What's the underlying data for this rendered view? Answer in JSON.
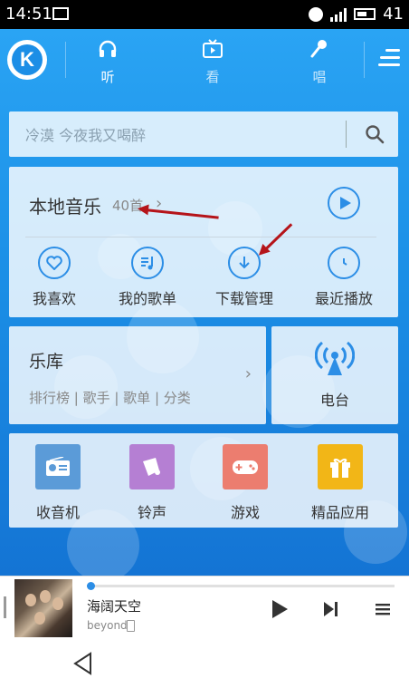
{
  "status": {
    "time": "14:51",
    "battery": "41"
  },
  "nav": {
    "tabs": [
      {
        "label": "听",
        "icon": "headphones-icon"
      },
      {
        "label": "看",
        "icon": "tv-icon"
      },
      {
        "label": "唱",
        "icon": "microphone-icon"
      }
    ]
  },
  "search": {
    "placeholder": "冷漠 今夜我又喝醉"
  },
  "local": {
    "title": "本地音乐",
    "count": "40首",
    "items": [
      {
        "label": "我喜欢",
        "icon": "heart-icon"
      },
      {
        "label": "我的歌单",
        "icon": "playlist-icon"
      },
      {
        "label": "下载管理",
        "icon": "download-icon"
      },
      {
        "label": "最近播放",
        "icon": "clock-icon"
      }
    ]
  },
  "library": {
    "title": "乐库",
    "tags": "排行榜 | 歌手 | 歌单 | 分类"
  },
  "radio": {
    "label": "电台"
  },
  "apps": [
    {
      "label": "收音机",
      "color": "#5b9bd8",
      "icon": "radio-icon"
    },
    {
      "label": "铃声",
      "color": "#b57fd3",
      "icon": "ringtone-icon"
    },
    {
      "label": "游戏",
      "color": "#ec7d6f",
      "icon": "gamepad-icon"
    },
    {
      "label": "精品应用",
      "color": "#f2b617",
      "icon": "gift-icon"
    }
  ],
  "player": {
    "song": "海阔天空",
    "artist": "beyond",
    "progress": 0.0
  },
  "colors": {
    "accent": "#2c8ee6",
    "annotation_arrow": "#b5141a"
  }
}
